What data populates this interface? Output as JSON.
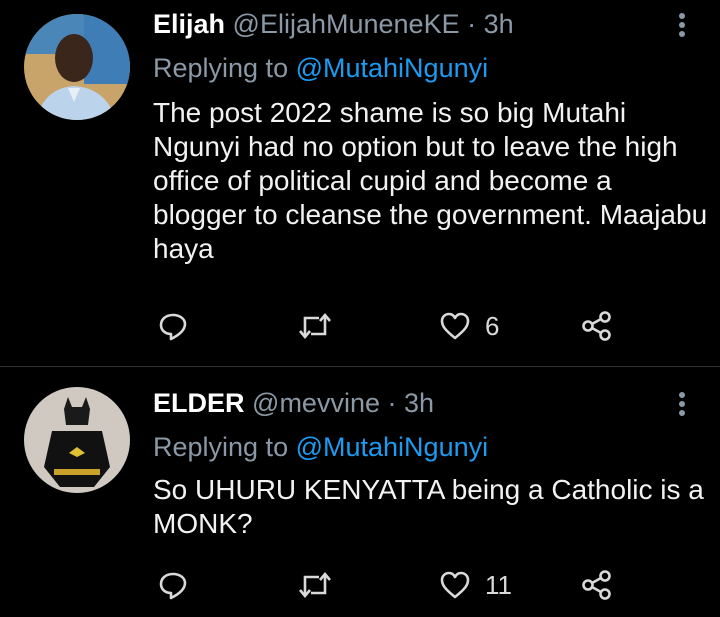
{
  "tweets": [
    {
      "name": "Elijah",
      "handle": "@ElijahMuneneKE",
      "time": "· 3h",
      "replying_prefix": "Replying to",
      "replying_to": "@MutahiNgunyi",
      "body": "The post 2022 shame is so big Mutahi Ngunyi had no option but to leave the high office of political cupid and become a blogger to cleanse the government. Maajabu haya",
      "retweets": "",
      "likes": "6"
    },
    {
      "name": "ELDER",
      "handle": "@mevvine",
      "time": "· 3h",
      "replying_prefix": "Replying to",
      "replying_to": "@MutahiNgunyi",
      "body": "So UHURU KENYATTA being a Catholic is a MONK?",
      "retweets": "",
      "likes": "11"
    }
  ],
  "colors": {
    "background": "#000000",
    "muted": "#8b98a5",
    "link": "#1d9bf0",
    "divider": "#2f3336"
  },
  "icons": [
    "reply-icon",
    "retweet-icon",
    "heart-icon",
    "share-icon",
    "more-icon"
  ]
}
